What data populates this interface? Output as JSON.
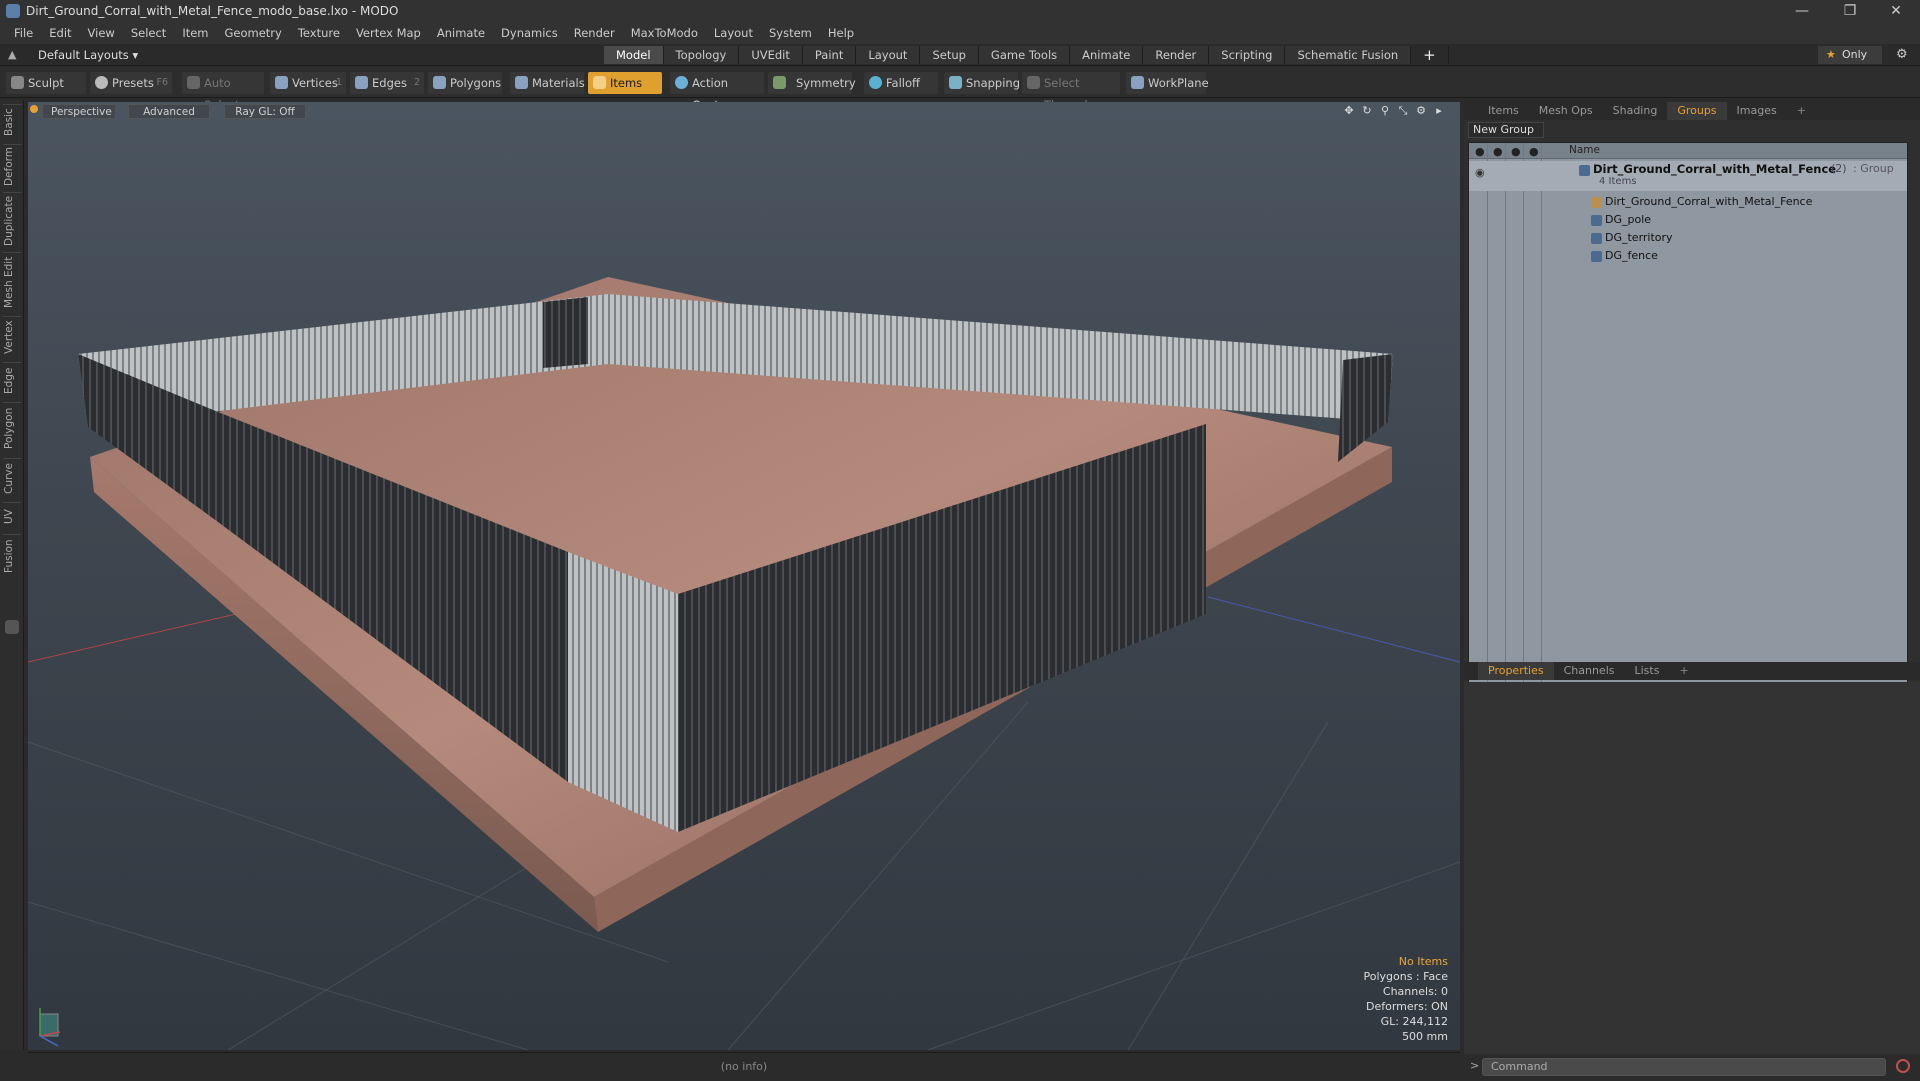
{
  "window": {
    "title": "Dirt_Ground_Corral_with_Metal_Fence_modo_base.lxo - MODO"
  },
  "menu": [
    "File",
    "Edit",
    "View",
    "Select",
    "Item",
    "Geometry",
    "Texture",
    "Vertex Map",
    "Animate",
    "Dynamics",
    "Render",
    "MaxToModo",
    "Layout",
    "System",
    "Help"
  ],
  "layout": {
    "selector": "Default Layouts ▾",
    "tabs": [
      "Model",
      "Topology",
      "UVEdit",
      "Paint",
      "Layout",
      "Setup",
      "Game Tools",
      "Animate",
      "Render",
      "Scripting",
      "Schematic Fusion"
    ],
    "active": "Model",
    "only": "Only"
  },
  "toolbar": {
    "sculpt": "Sculpt",
    "presets": "Presets",
    "presets_key": "F6",
    "auto_select": "Auto Select",
    "vertices": "Vertices",
    "vertices_key": "1",
    "edges": "Edges",
    "edges_key": "2",
    "polygons": "Polygons",
    "materials": "Materials",
    "items": "Items",
    "action_center": "Action Center",
    "symmetry": "Symmetry",
    "falloff": "Falloff",
    "snapping": "Snapping",
    "select_through": "Select Through",
    "workplane": "WorkPlane"
  },
  "left_tabs": [
    "Basic",
    "Deform",
    "Duplicate",
    "Mesh Edit",
    "Vertex",
    "Edge",
    "Polygon",
    "Curve",
    "UV",
    "Fusion"
  ],
  "viewport": {
    "perspective": "Perspective",
    "advanced": "Advanced",
    "raygl": "Ray GL: Off",
    "stats": {
      "no_items": "No Items",
      "polygons": "Polygons : Face",
      "channels": "Channels: 0",
      "deformers": "Deformers: ON",
      "gl": "GL: 244,112",
      "scale": "500 mm"
    }
  },
  "status": {
    "info": "(no info)"
  },
  "right_panel": {
    "tabs": [
      "Items",
      "Mesh Ops",
      "Shading",
      "Groups",
      "Images"
    ],
    "active_tab": "Groups",
    "new_group": "New Group",
    "list_header": "Name",
    "group": {
      "name": "Dirt_Ground_Corral_with_Metal_Fence",
      "count": "(2)",
      "type": ": Group",
      "sub": "4 Items"
    },
    "items": [
      "Dirt_Ground_Corral_with_Metal_Fence",
      "DG_pole",
      "DG_territory",
      "DG_fence"
    ],
    "bottom_tabs": [
      "Properties",
      "Channels",
      "Lists"
    ],
    "bottom_active": "Properties",
    "command_placeholder": "Command"
  },
  "colors": {
    "accent": "#e8a030",
    "list_bg": "#8f98a0"
  }
}
